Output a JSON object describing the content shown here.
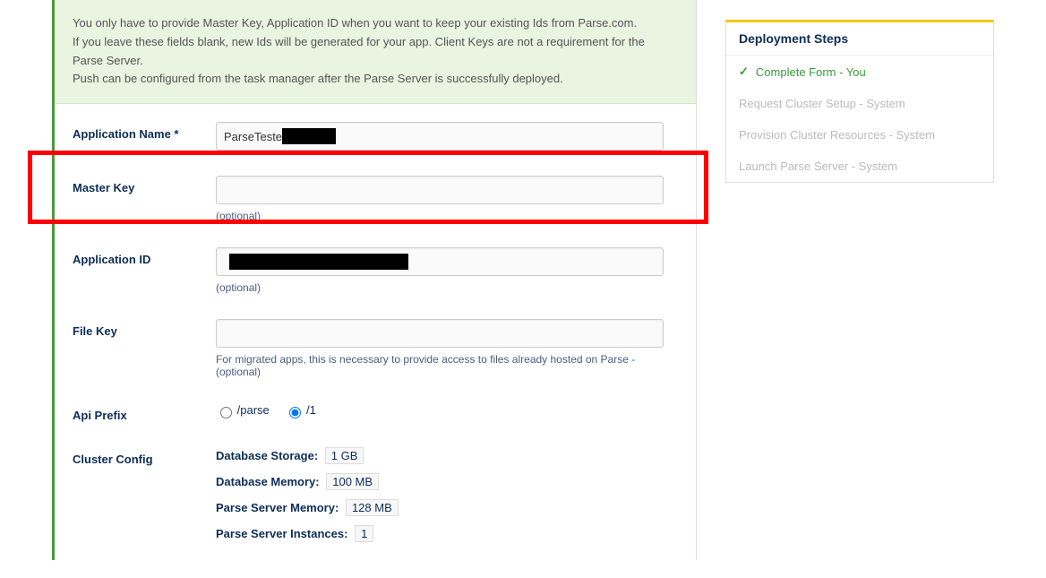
{
  "notice": {
    "line1": "You only have to provide Master Key, Application ID when you want to keep your existing Ids from Parse.com.",
    "line2": "If you leave these fields blank, new Ids will be generated for your app. Client Keys are not a requirement for the Parse Server.",
    "line3": "Push can be configured from the task manager after the Parse Server is successfully deployed."
  },
  "form": {
    "appName": {
      "label": "Application Name *",
      "value": "ParseTeste"
    },
    "masterKey": {
      "label": "Master Key",
      "value": "",
      "hint": "(optional)"
    },
    "appId": {
      "label": "Application ID",
      "value": "",
      "hint": "(optional)"
    },
    "fileKey": {
      "label": "File Key",
      "value": "",
      "hint": "For migrated apps, this is necessary to provide access to files already hosted on Parse - (optional)"
    },
    "apiPrefix": {
      "label": "Api Prefix",
      "options": [
        {
          "value": "/parse",
          "checked": false
        },
        {
          "value": "/1",
          "checked": true
        }
      ]
    },
    "cluster": {
      "label": "Cluster Config",
      "dbStorageLabel": "Database Storage:",
      "dbStorageValue": "1 GB",
      "dbMemoryLabel": "Database Memory:",
      "dbMemoryValue": "100 MB",
      "psMemoryLabel": "Parse Server Memory:",
      "psMemoryValue": "128 MB",
      "psInstancesLabel": "Parse Server Instances:",
      "psInstancesValue": "1"
    }
  },
  "side": {
    "title": "Deployment Steps",
    "steps": [
      {
        "label": "Complete Form - You",
        "active": true
      },
      {
        "label": "Request Cluster Setup - System",
        "active": false
      },
      {
        "label": "Provision Cluster Resources - System",
        "active": false
      },
      {
        "label": "Launch Parse Server - System",
        "active": false
      }
    ]
  }
}
